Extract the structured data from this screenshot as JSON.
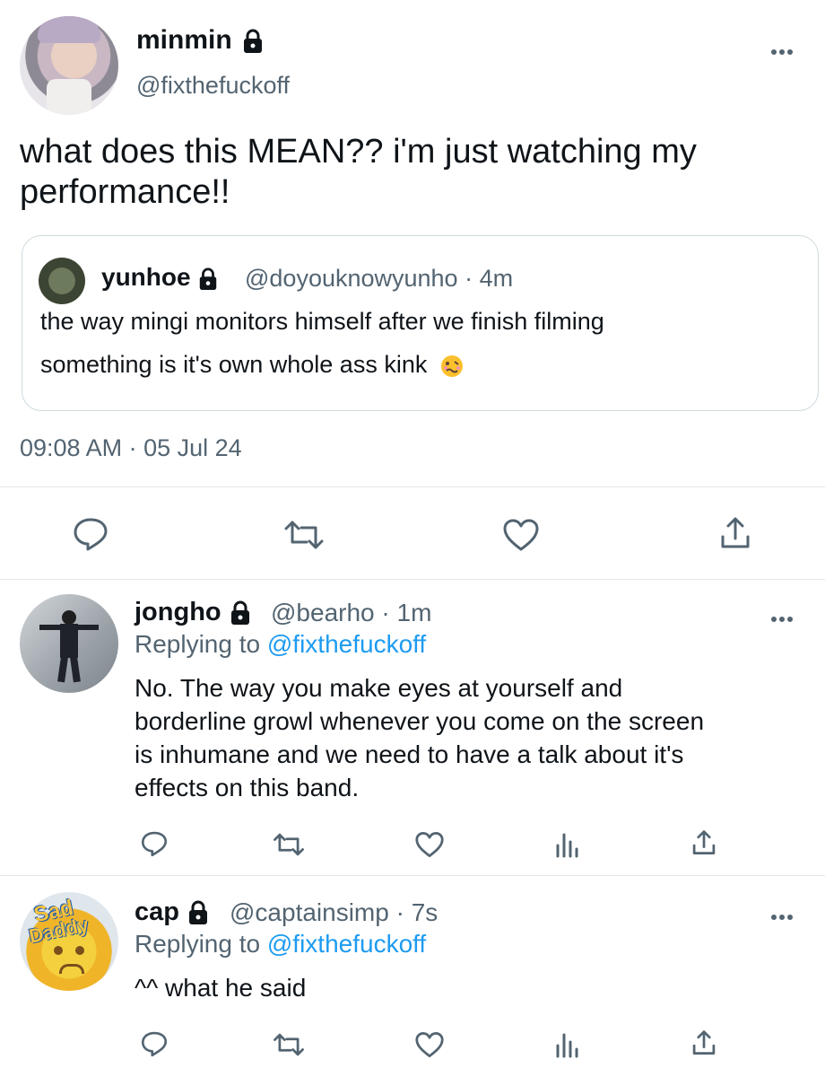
{
  "main_tweet": {
    "display_name": "minmin",
    "handle": "@fixthefuckoff",
    "text_line1": "what does this MEAN?? i'm just watching my",
    "text_line2": "performance!!",
    "timestamp": "09:08 AM · 05 Jul 24"
  },
  "quoted_tweet": {
    "display_name": "yunhoe",
    "handle_time": "@doyouknowyunho · 4m",
    "text_line1": "the way mingi monitors himself after we finish filming",
    "text_line2": "something is it's own whole ass kink"
  },
  "replies": [
    {
      "display_name": "jongho",
      "handle_time": "@bearho · 1m",
      "replying_prefix": "Replying to",
      "replying_to": "@fixthefuckoff",
      "lines": [
        "No. The way you make eyes at yourself and",
        "borderline growl whenever you come on the screen",
        "is inhumane and we need to have a talk about it's",
        "effects on this band."
      ]
    },
    {
      "display_name": "cap",
      "handle_time": "@captainsimp · 7s",
      "replying_prefix": "Replying to",
      "replying_to": "@fixthefuckoff",
      "lines": [
        "^^ what he said"
      ],
      "avatar_text_1": "Sad",
      "avatar_text_2": "Daddy"
    }
  ],
  "colors": {
    "link": "#1d9bf0",
    "muted": "#536471",
    "divider": "#e3e6e9"
  },
  "icons": [
    "reply-icon",
    "retweet-icon",
    "like-icon",
    "share-icon",
    "analytics-icon",
    "lock-icon",
    "more-icon"
  ]
}
